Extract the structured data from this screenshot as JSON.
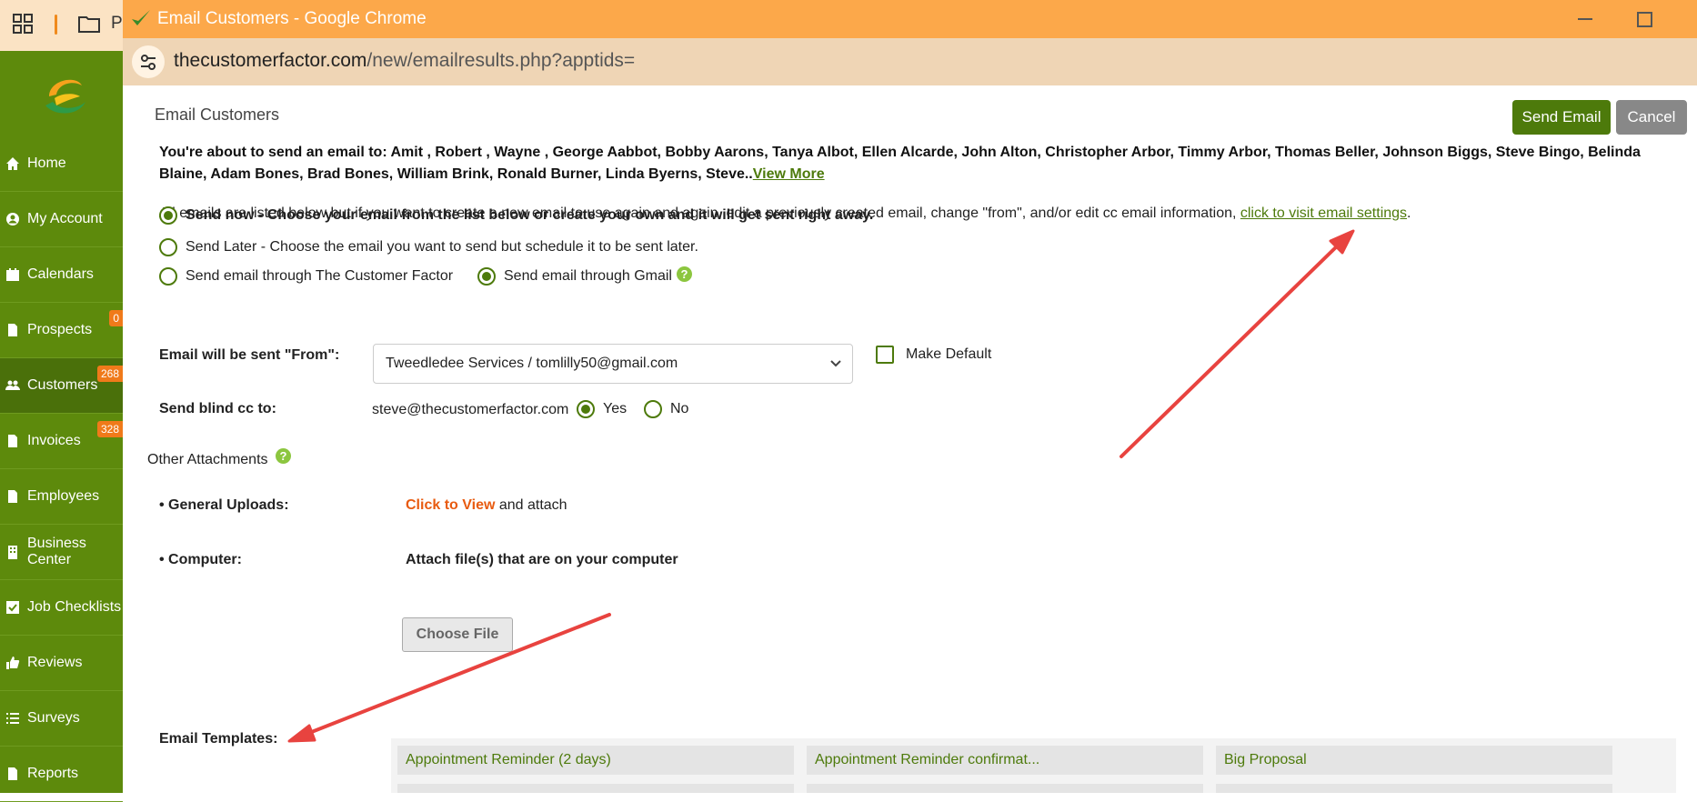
{
  "taskbar": {
    "partial_label": "P"
  },
  "sidebar": {
    "items": [
      {
        "label": "Home",
        "icon": "home-icon"
      },
      {
        "label": "My Account",
        "icon": "user-circle-icon"
      },
      {
        "label": "Calendars",
        "icon": "calendar-icon"
      },
      {
        "label": "Prospects",
        "icon": "file-icon",
        "badge": "0"
      },
      {
        "label": "Customers",
        "icon": "users-icon",
        "badge": "268",
        "active": true
      },
      {
        "label": "Invoices",
        "icon": "file-icon",
        "badge": "328"
      },
      {
        "label": "Employees",
        "icon": "file-icon"
      },
      {
        "label": "Business Center",
        "icon": "building-icon"
      },
      {
        "label": "Job Checklists",
        "icon": "checkbox-icon"
      },
      {
        "label": "Reviews",
        "icon": "thumbs-up-icon"
      },
      {
        "label": "Surveys",
        "icon": "list-icon"
      },
      {
        "label": "Reports",
        "icon": "file-icon"
      }
    ]
  },
  "browser": {
    "window_title": "Email Customers - Google Chrome",
    "url_domain": "thecustomerfactor.com",
    "url_path": "/new/emailresults.php?apptids="
  },
  "page": {
    "title": "Email Customers",
    "send_button": "Send Email",
    "cancel_button": "Cancel",
    "recipients_text": "You're about to send an email to: Amit , Robert , Wayne , George Aabbot, Bobby Aarons, Tanya Albot, Ellen Alcarde, John Alton, Christopher Arbor, Timmy Arbor, Thomas Beller, Johnson Biggs, Steve Bingo, Belinda Blaine, Adam Bones, Brad Bones, William Brink, Ronald Burner, Linda Byerns, Steve..",
    "view_more": "View More",
    "info_text": "All emails are listed below but if you want to create a new email to use again and again, edit a previously created email, change \"from\", and/or edit cc email information, ",
    "settings_link": "click to visit email settings",
    "info_end": ".",
    "send_now": "Send now - Choose your email from the list below or create your own and it will get sent right away.",
    "send_later": "Send Later - Choose the email you want to send but schedule it to be sent later.",
    "via_tcf": "Send email through The Customer Factor",
    "via_gmail": "Send email through Gmail",
    "help": "?",
    "from_label": "Email will be sent \"From\":",
    "from_value": "Tweedledee Services / tomlilly50@gmail.com",
    "make_default": "Make Default",
    "bcc_label": "Send blind cc to:",
    "bcc_email": "steve@thecustomerfactor.com",
    "yes": "Yes",
    "no": "No",
    "attachments_title": "Other Attachments",
    "general_uploads_label": "• General Uploads:",
    "click_to_view": "Click to View",
    "and_attach": " and attach",
    "computer_label": "• Computer:",
    "attach_text": "Attach file(s) that are on your computer",
    "choose_file": "Choose File",
    "templates_label": "Email Templates:",
    "templates": [
      "Appointment Reminder (2 days)",
      "Appointment Reminder confirmat...",
      "Big Proposal"
    ]
  },
  "colors": {
    "accent": "#4d7a0b",
    "sidebar": "#5d8a0c",
    "titlebar": "#fca84a",
    "annotation": "#e8433f"
  }
}
